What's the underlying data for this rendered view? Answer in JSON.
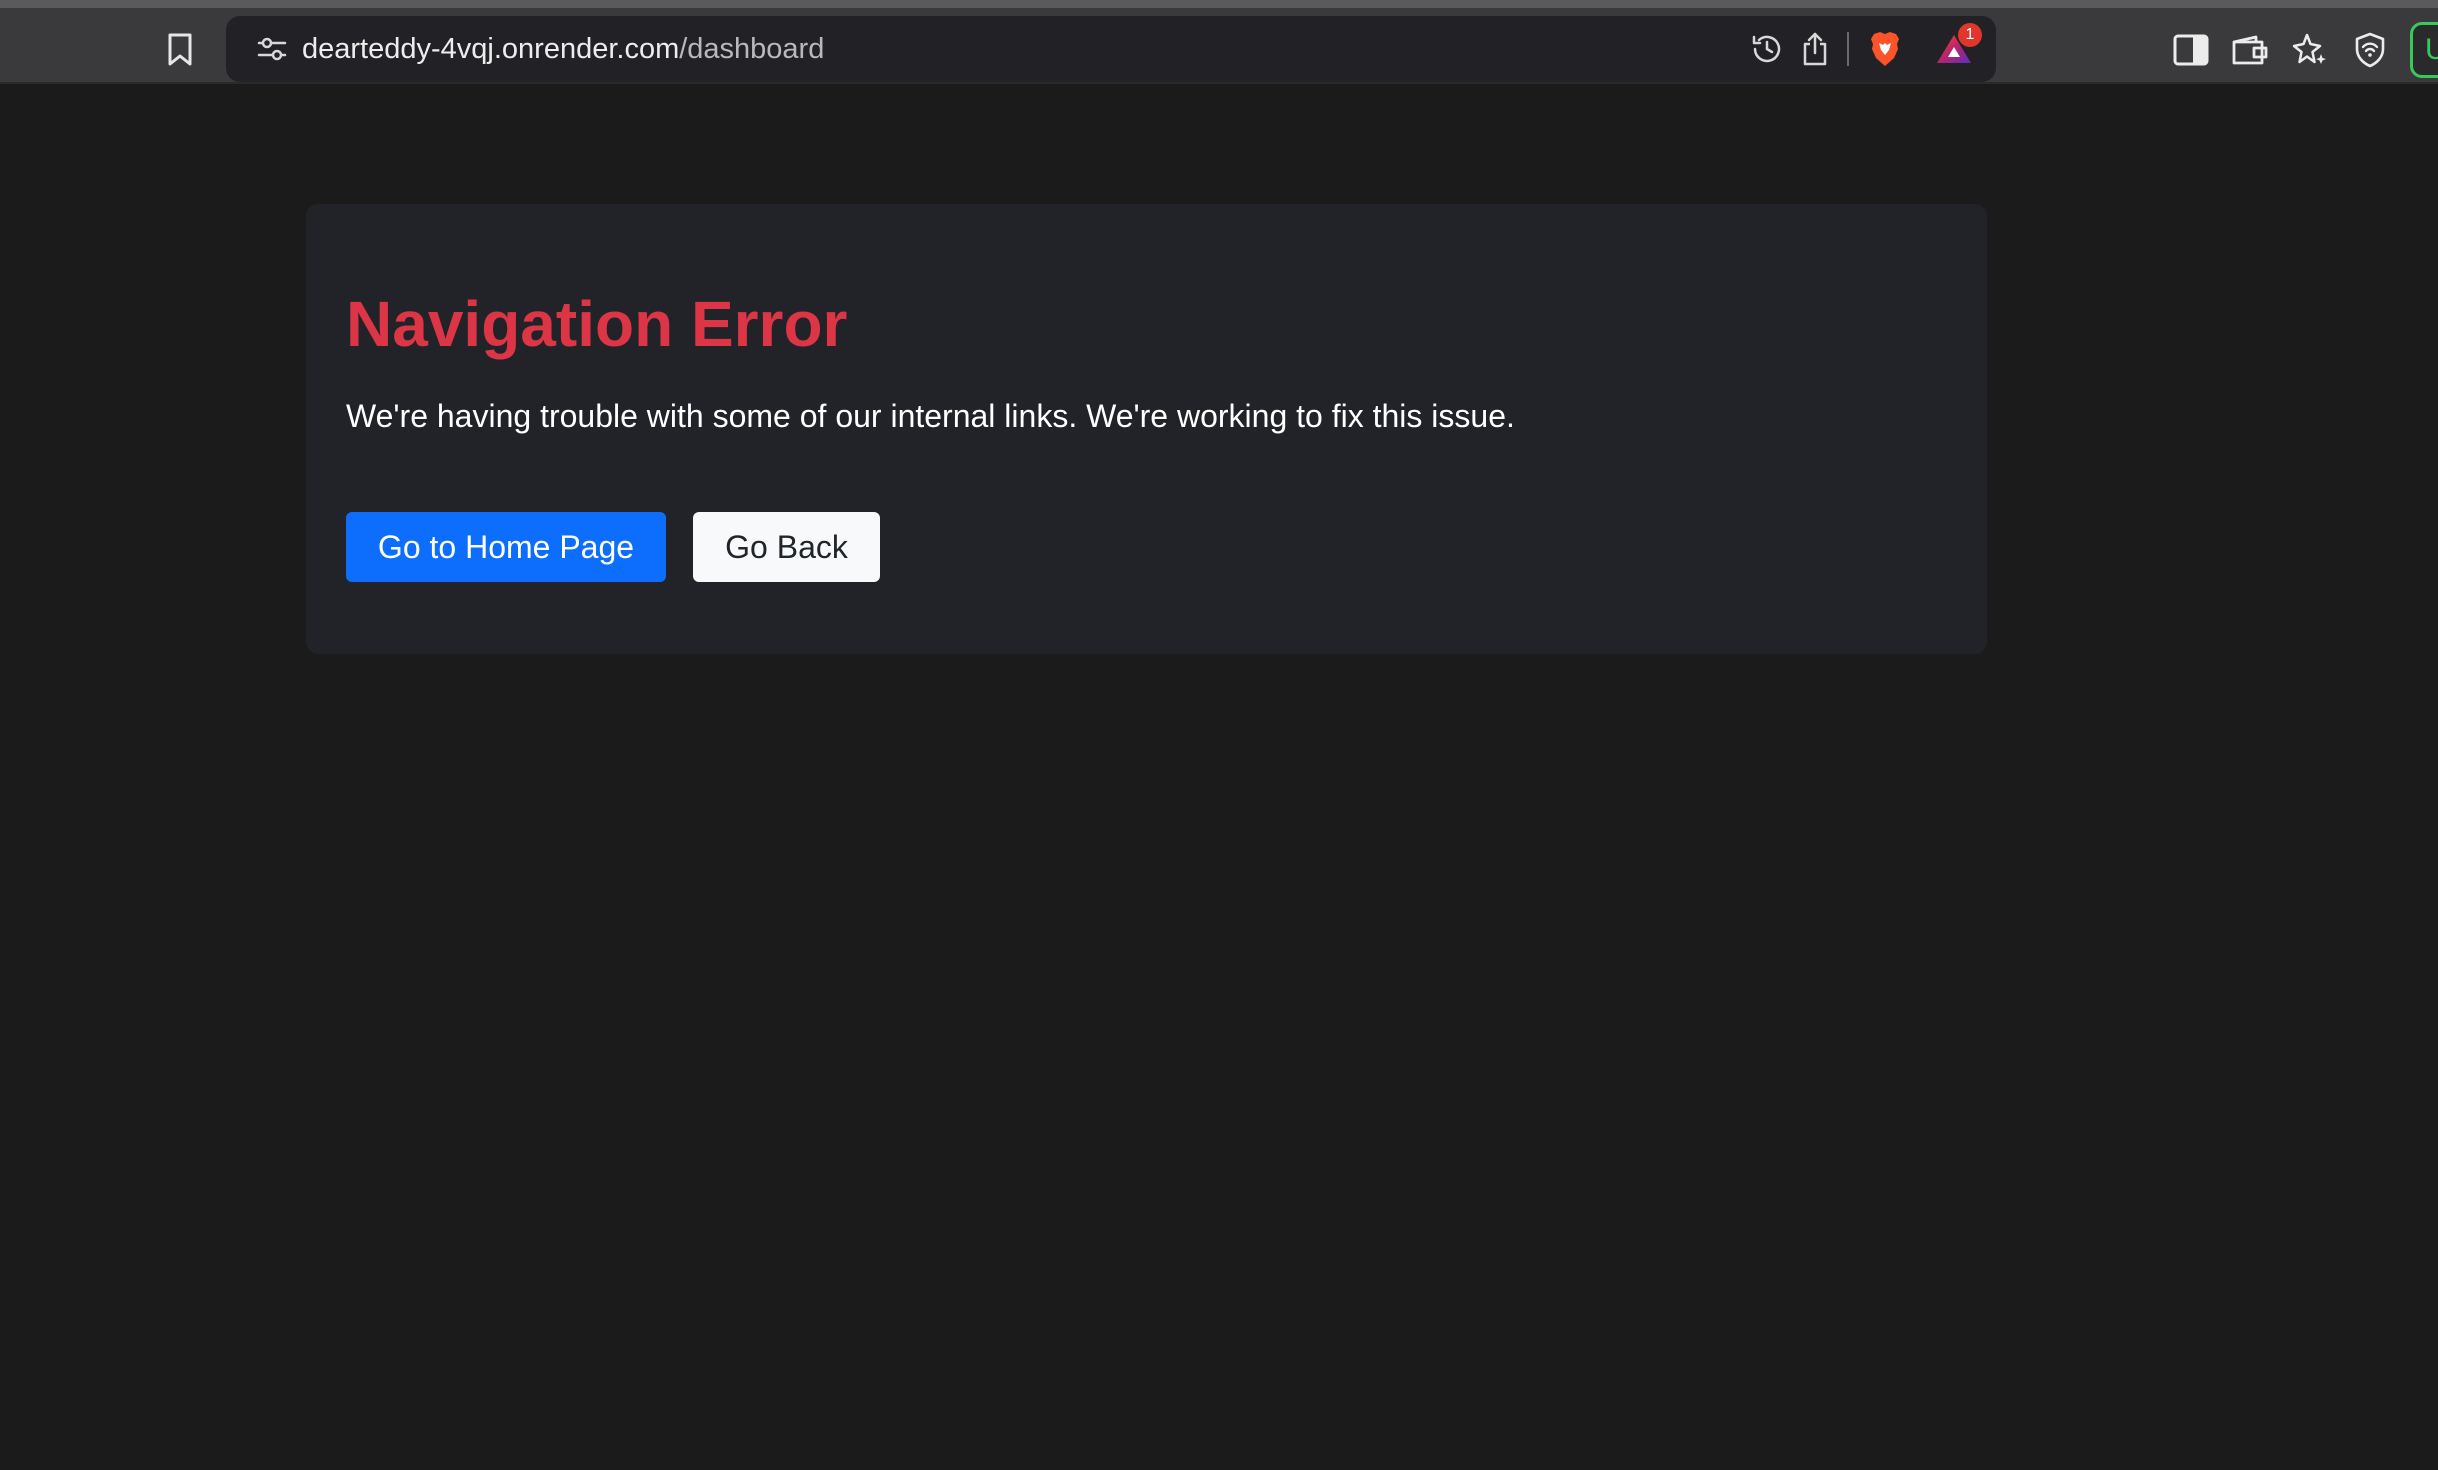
{
  "browser": {
    "url": {
      "domain": "dearteddy-4vqj.onrender.com",
      "path": "/dashboard"
    },
    "rewards_badge_count": "1",
    "profile_letter": "U",
    "icons": {
      "bookmark": "bookmark-icon",
      "site_settings": "site-settings-icon",
      "history": "history-icon",
      "share": "share-icon",
      "brave_shields": "brave-shields-icon",
      "brave_rewards": "brave-rewards-icon",
      "sidebar": "sidebar-icon",
      "wallet": "wallet-icon",
      "leo_ai": "leo-ai-icon",
      "vpn": "vpn-icon"
    }
  },
  "page": {
    "title": "Navigation Error",
    "message": "We're having trouble with some of our internal links. We're working to fix this issue.",
    "buttons": {
      "home": "Go to Home Page",
      "back": "Go Back"
    }
  },
  "colors": {
    "page_background": "#1b1b1b",
    "card_background": "#212329",
    "title": "#dc3545",
    "primary_button": "#0d6efd",
    "light_button": "#f8f9fa",
    "browser_chrome": "#3a3a3d",
    "profile_accent": "#38c95a"
  }
}
